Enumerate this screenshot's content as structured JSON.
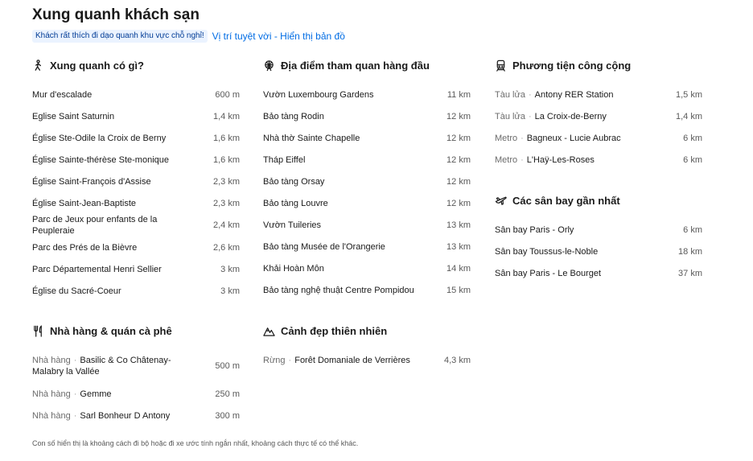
{
  "header": {
    "title": "Xung quanh khách sạn",
    "badge": "Khách rất thích đi dạo quanh khu vực chỗ nghỉ!",
    "location_link": "Vị trí tuyệt vời - Hiển thị bản đồ"
  },
  "sections": {
    "around": {
      "title": "Xung quanh có gì?",
      "icon": "walking-person-icon",
      "items": [
        {
          "name": "Mur d'escalade",
          "dist": "600 m"
        },
        {
          "name": "Eglise Saint Saturnin",
          "dist": "1,4 km"
        },
        {
          "name": "Église Ste-Odile la Croix de Berny",
          "dist": "1,6 km"
        },
        {
          "name": "Église Sainte-thérèse Ste-monique",
          "dist": "1,6 km"
        },
        {
          "name": "Église Saint-François d'Assise",
          "dist": "2,3 km"
        },
        {
          "name": "Église Saint-Jean-Baptiste",
          "dist": "2,3 km"
        },
        {
          "name": "Parc de Jeux pour enfants de la Peupleraie",
          "dist": "2,4 km"
        },
        {
          "name": "Parc des Prés de la Bièvre",
          "dist": "2,6 km"
        },
        {
          "name": "Parc Départemental Henri Sellier",
          "dist": "3 km"
        },
        {
          "name": "Église du Sacré-Coeur",
          "dist": "3 km"
        }
      ]
    },
    "attractions": {
      "title": "Địa điểm tham quan hàng đầu",
      "icon": "ferris-wheel-icon",
      "items": [
        {
          "name": "Vườn Luxembourg Gardens",
          "dist": "11 km"
        },
        {
          "name": "Bảo tàng Rodin",
          "dist": "12 km"
        },
        {
          "name": "Nhà thờ Sainte Chapelle",
          "dist": "12 km"
        },
        {
          "name": "Tháp Eiffel",
          "dist": "12 km"
        },
        {
          "name": "Bảo tàng Orsay",
          "dist": "12 km"
        },
        {
          "name": "Bảo tàng Louvre",
          "dist": "12 km"
        },
        {
          "name": "Vườn Tuileries",
          "dist": "13 km"
        },
        {
          "name": "Bảo tàng Musée de l'Orangerie",
          "dist": "13 km"
        },
        {
          "name": "Khải Hoàn Môn",
          "dist": "14 km"
        },
        {
          "name": "Bảo tàng nghệ thuật Centre Pompidou",
          "dist": "15 km"
        }
      ]
    },
    "transit": {
      "title": "Phương tiện công cộng",
      "icon": "train-icon",
      "items": [
        {
          "cat": "Tàu lửa",
          "name": "Antony RER Station",
          "dist": "1,5 km"
        },
        {
          "cat": "Tàu lửa",
          "name": "La Croix-de-Berny",
          "dist": "1,4 km"
        },
        {
          "cat": "Metro",
          "name": "Bagneux - Lucie Aubrac",
          "dist": "6 km"
        },
        {
          "cat": "Metro",
          "name": "L'Haÿ-Les-Roses",
          "dist": "6 km"
        }
      ]
    },
    "airports": {
      "title": "Các sân bay gần nhất",
      "icon": "airplane-icon",
      "items": [
        {
          "name": "Sân bay Paris - Orly",
          "dist": "6 km"
        },
        {
          "name": "Sân bay Toussus-le-Noble",
          "dist": "18 km"
        },
        {
          "name": "Sân bay Paris - Le Bourget",
          "dist": "37 km"
        }
      ]
    },
    "restaurants": {
      "title": "Nhà hàng & quán cà phê",
      "icon": "fork-knife-icon",
      "items": [
        {
          "cat": "Nhà hàng",
          "name": "Basilic & Co Châtenay-Malabry la Vallée",
          "dist": "500 m"
        },
        {
          "cat": "Nhà hàng",
          "name": "Gemme",
          "dist": "250 m"
        },
        {
          "cat": "Nhà hàng",
          "name": "Sarl Bonheur D Antony",
          "dist": "300 m"
        }
      ]
    },
    "nature": {
      "title": "Cảnh đẹp thiên nhiên",
      "icon": "mountain-icon",
      "items": [
        {
          "cat": "Rừng",
          "name": "Forêt Domaniale de Verrières",
          "dist": "4,3 km"
        }
      ]
    }
  },
  "footnote": "Con số hiển thị là khoảng cách đi bộ hoặc đi xe ước tính ngắn nhất, khoảng cách thực tế có thể khác.",
  "colors": {
    "link": "#006ce4",
    "badge_bg": "#ebf3ff",
    "badge_text": "#003b95"
  }
}
